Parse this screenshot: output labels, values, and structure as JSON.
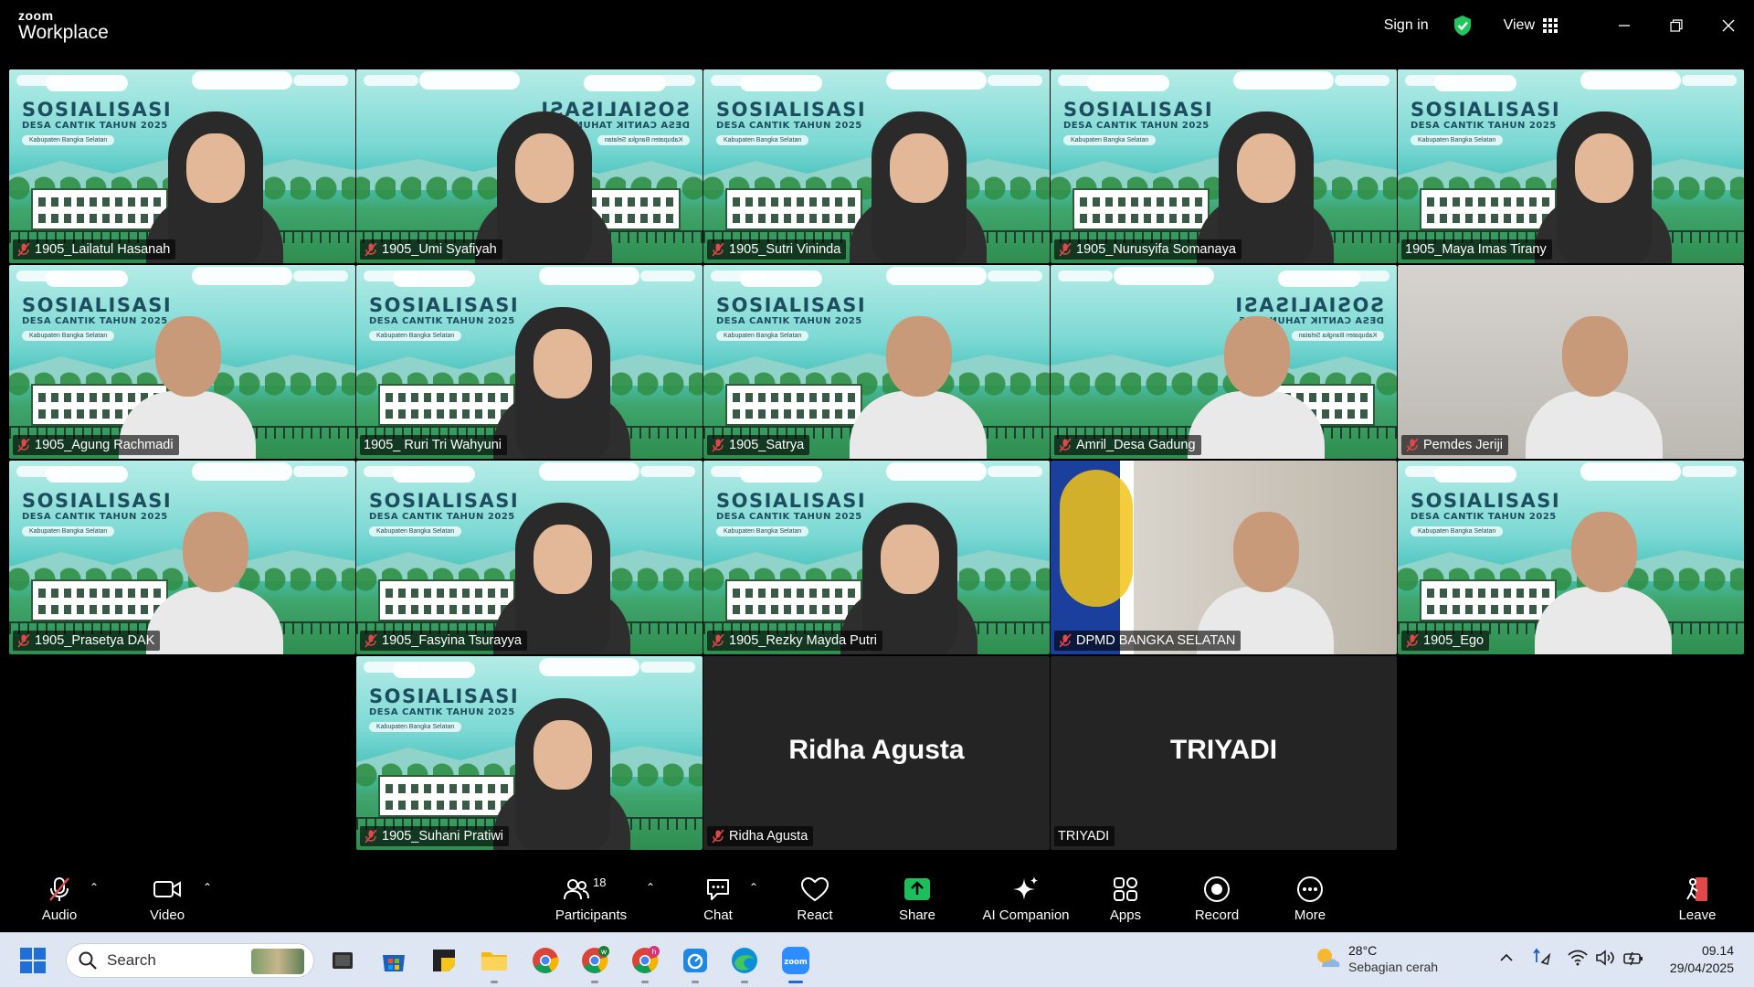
{
  "app": {
    "logo_small": "zoom",
    "logo_large": "Workplace",
    "sign_in": "Sign in",
    "view": "View",
    "accent": "#2fe36a",
    "mute_color": "#e0484a"
  },
  "participants": [
    {
      "name": "1905_Lailatul Hasanah",
      "muted": true
    },
    {
      "name": "1905_Umi Syafiyah",
      "muted": true
    },
    {
      "name": "1905_Sutri Vininda",
      "muted": true
    },
    {
      "name": "1905_Nurusyifa Somanaya",
      "muted": true
    },
    {
      "name": "1905_Maya Imas Tirany",
      "muted": false,
      "active_speaker": true
    },
    {
      "name": "1905_Agung Rachmadi",
      "muted": true
    },
    {
      "name": "1905_ Ruri Tri Wahyuni",
      "muted": false
    },
    {
      "name": "1905_Satrya",
      "muted": true
    },
    {
      "name": "Amril_Desa Gadung",
      "muted": true
    },
    {
      "name": "Pemdes Jeriji",
      "muted": true
    },
    {
      "name": "1905_Prasetya DAK",
      "muted": true
    },
    {
      "name": "1905_Fasyina Tsurayya",
      "muted": true
    },
    {
      "name": "1905_Rezky Mayda Putri",
      "muted": true
    },
    {
      "name": "DPMD BANGKA SELATAN",
      "muted": true
    },
    {
      "name": "1905_Ego",
      "muted": true
    },
    {
      "name": "1905_Suhani Pratiwi",
      "muted": true
    },
    {
      "name": "Ridha Agusta",
      "muted": true,
      "video_off": true,
      "big_label": "Ridha Agusta"
    },
    {
      "name": "TRIYADI",
      "muted": false,
      "video_off": true,
      "big_label": "TRIYADI"
    }
  ],
  "background": {
    "title": "SOSIALISASI",
    "subtitle": "DESA CANTIK TAHUN 2025",
    "region": "Kabupaten Bangka Selatan"
  },
  "toolbar": {
    "audio": "Audio",
    "video": "Video",
    "participants": "Participants",
    "participant_count": "18",
    "chat": "Chat",
    "react": "React",
    "share": "Share",
    "ai_companion": "AI Companion",
    "apps": "Apps",
    "record": "Record",
    "more": "More",
    "leave": "Leave",
    "share_color": "#1dbf5c",
    "leave_color": "#e0484a"
  },
  "taskbar": {
    "search_placeholder": "Search",
    "apps": [
      "task-view",
      "microsoft-store",
      "sticky-notes",
      "file-explorer",
      "chrome",
      "chrome-profile-w",
      "chrome-profile-h",
      "snipping-tool",
      "edge",
      "zoom"
    ],
    "weather_temp": "28°C",
    "weather_desc": "Sebagian cerah",
    "time": "09.14",
    "date": "29/04/2025"
  }
}
